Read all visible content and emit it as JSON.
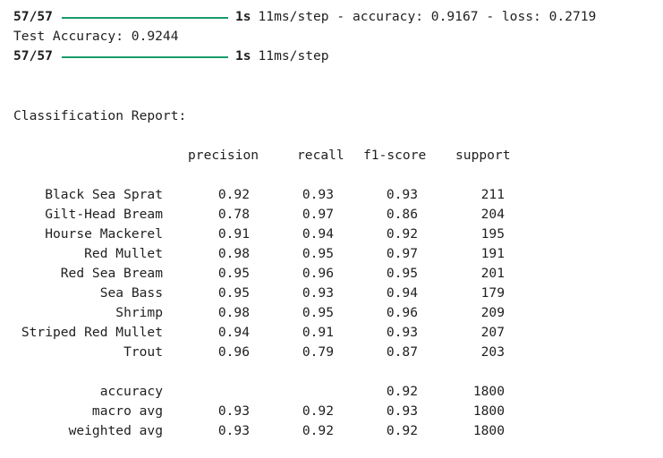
{
  "log_line_1": {
    "progress": "57/57",
    "time": "1s",
    "rest": "11ms/step - accuracy: 0.9167 - loss: 0.2719"
  },
  "test_accuracy": "Test Accuracy: 0.9244",
  "log_line_2": {
    "progress": "57/57",
    "time": "1s",
    "rest": "11ms/step"
  },
  "report": {
    "title": "Classification Report:",
    "headers": {
      "precision": "precision",
      "recall": "recall",
      "f1": "f1-score",
      "support": "support"
    },
    "classes": [
      {
        "label": "Black Sea Sprat",
        "precision": "0.92",
        "recall": "0.93",
        "f1": "0.93",
        "support": "211"
      },
      {
        "label": "Gilt-Head Bream",
        "precision": "0.78",
        "recall": "0.97",
        "f1": "0.86",
        "support": "204"
      },
      {
        "label": "Hourse Mackerel",
        "precision": "0.91",
        "recall": "0.94",
        "f1": "0.92",
        "support": "195"
      },
      {
        "label": "Red Mullet",
        "precision": "0.98",
        "recall": "0.95",
        "f1": "0.97",
        "support": "191"
      },
      {
        "label": "Red Sea Bream",
        "precision": "0.95",
        "recall": "0.96",
        "f1": "0.95",
        "support": "201"
      },
      {
        "label": "Sea Bass",
        "precision": "0.95",
        "recall": "0.93",
        "f1": "0.94",
        "support": "179"
      },
      {
        "label": "Shrimp",
        "precision": "0.98",
        "recall": "0.95",
        "f1": "0.96",
        "support": "209"
      },
      {
        "label": "Striped Red Mullet",
        "precision": "0.94",
        "recall": "0.91",
        "f1": "0.93",
        "support": "207"
      },
      {
        "label": "Trout",
        "precision": "0.96",
        "recall": "0.79",
        "f1": "0.87",
        "support": "203"
      }
    ],
    "summary": [
      {
        "label": "accuracy",
        "precision": "",
        "recall": "",
        "f1": "0.92",
        "support": "1800"
      },
      {
        "label": "macro avg",
        "precision": "0.93",
        "recall": "0.92",
        "f1": "0.93",
        "support": "1800"
      },
      {
        "label": "weighted avg",
        "precision": "0.93",
        "recall": "0.92",
        "f1": "0.92",
        "support": "1800"
      }
    ]
  },
  "colors": {
    "progress_bar": "#1a9c6b",
    "text": "#1f1f1f",
    "background": "#ffffff"
  }
}
